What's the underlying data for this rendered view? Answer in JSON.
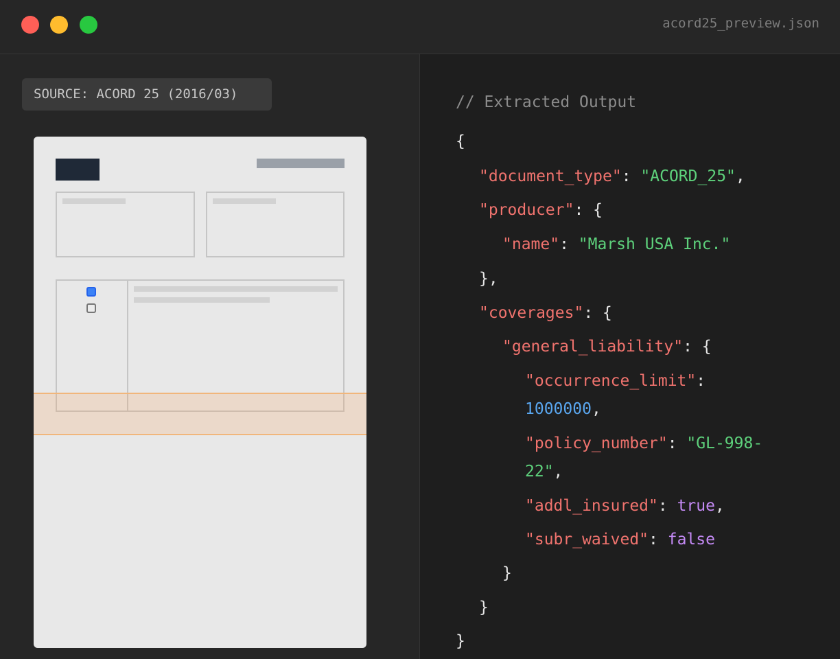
{
  "window": {
    "filename": "acord25_preview.json",
    "controls": [
      "close",
      "minimize",
      "maximize"
    ]
  },
  "source_panel": {
    "tag": "SOURCE: ACORD 25 (2016/03)"
  },
  "code_panel": {
    "comment": "// Extracted Output",
    "open_brace": "{",
    "close_brace": "}",
    "lines": {
      "document_type_key": "\"document_type\"",
      "document_type_value": "\"ACORD_25\"",
      "producer_key": "\"producer\"",
      "name_key": "\"name\"",
      "name_value": "\"Marsh USA Inc.\"",
      "coverages_key": "\"coverages\"",
      "general_liability_key": "\"general_liability\"",
      "occurrence_limit_key": "\"occurrence_limit\"",
      "occurrence_limit_value": "1000000",
      "policy_number_key": "\"policy_number\"",
      "policy_number_value_part1": "\"GL-998-",
      "policy_number_value_part2": "22\"",
      "addl_insured_key": "\"addl_insured\"",
      "addl_insured_value": "true",
      "subr_waived_key": "\"subr_waived\"",
      "subr_waived_value": "false"
    }
  },
  "colors": {
    "key": "#f0736e",
    "string": "#5ed27c",
    "number": "#5aa7f0",
    "boolean": "#c48af5",
    "highlight": "#f1b67b"
  }
}
